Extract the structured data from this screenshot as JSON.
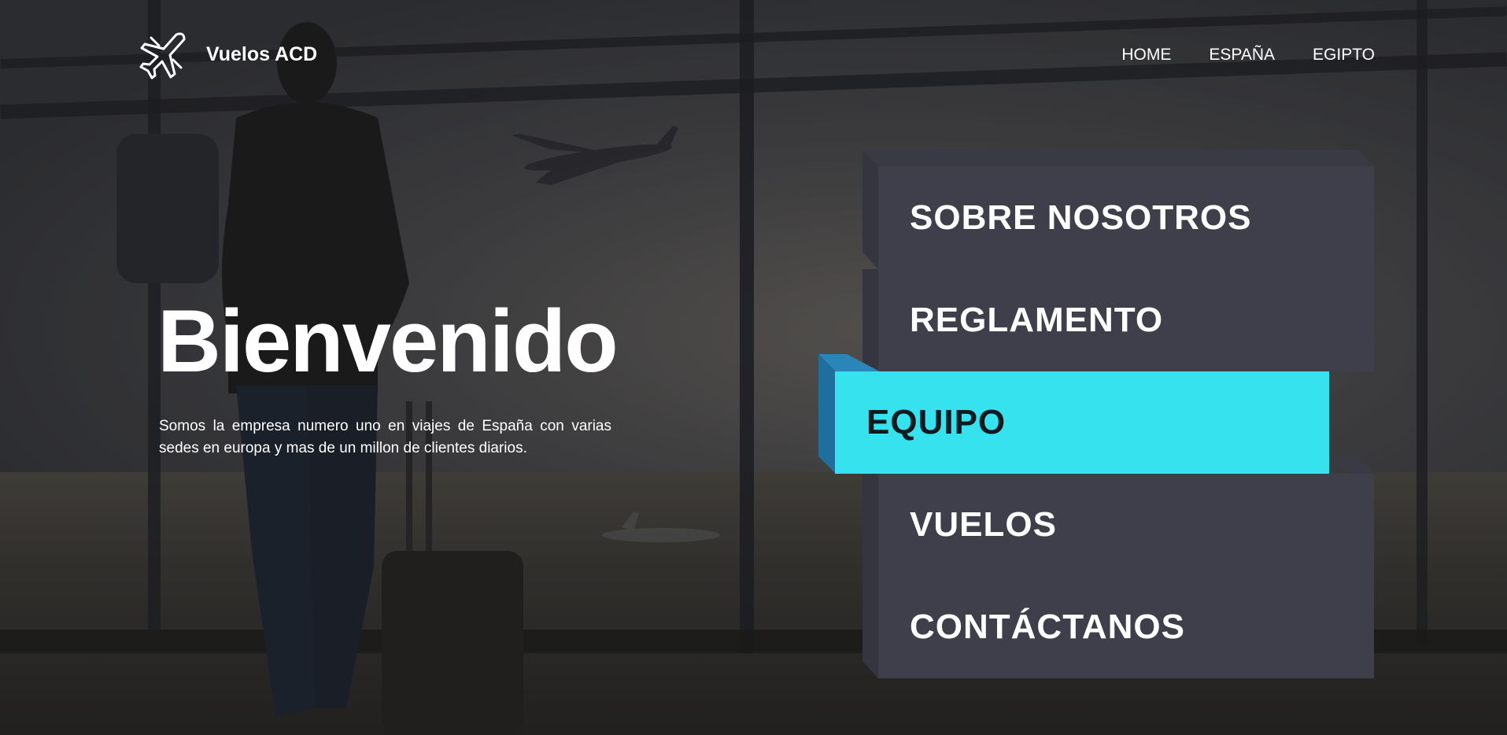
{
  "header": {
    "brand": "Vuelos ACD",
    "logo_icon": "airplane-icon",
    "nav": [
      {
        "label": "HOME"
      },
      {
        "label": "ESPAÑA"
      },
      {
        "label": "EGIPTO"
      }
    ]
  },
  "hero": {
    "title": "Bienvenido",
    "text": "Somos la empresa numero uno en viajes de España con varias sedes en europa y mas de un millon de clientes diarios."
  },
  "menu": {
    "items": [
      {
        "label": "SOBRE NOSOTROS",
        "active": false
      },
      {
        "label": "REGLAMENTO",
        "active": false
      },
      {
        "label": "EQUIPO",
        "active": true
      },
      {
        "label": "VUELOS",
        "active": false
      },
      {
        "label": "CONTÁCTANOS",
        "active": false
      }
    ]
  },
  "colors": {
    "menu_face": "#3f3f4c",
    "menu_active": "#36e2ee",
    "menu_active_side": "#1f6f9e",
    "text": "#ffffff"
  }
}
